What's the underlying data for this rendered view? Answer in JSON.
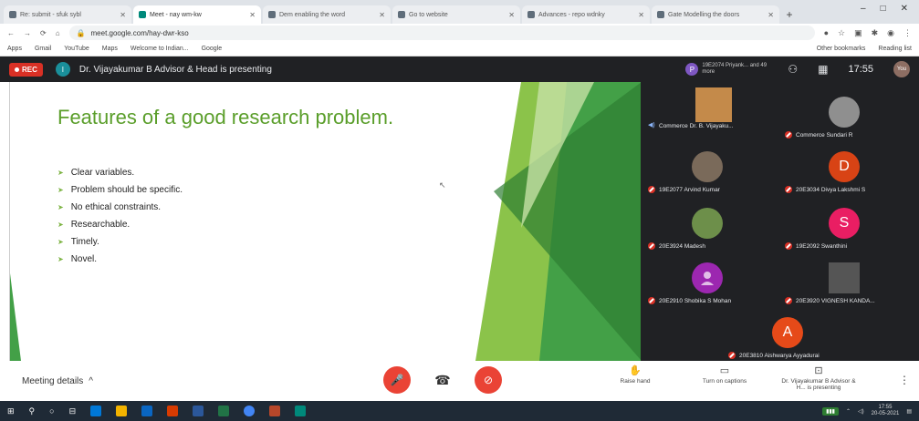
{
  "browser": {
    "tabs": [
      {
        "label": "Re: submit - sfuk sybl",
        "active": false
      },
      {
        "label": "Meet - nay wm-kw",
        "active": true
      },
      {
        "label": "Dem enabling the word",
        "active": false
      },
      {
        "label": "Go to website",
        "active": false
      },
      {
        "label": "Advances - repo wdnky",
        "active": false
      },
      {
        "label": "Gate Modelling the doors",
        "active": false
      }
    ],
    "new_tab": "+",
    "window_controls": [
      "–",
      "□",
      "✕"
    ],
    "url": "meet.google.com/hay-dwr-kso",
    "bookmarks": [
      "Apps",
      "Gmail",
      "YouTube",
      "Maps",
      "Welcome to Indian...",
      "Google"
    ],
    "bookmarks_right": [
      "Other bookmarks",
      "Reading list"
    ]
  },
  "meet": {
    "rec_label": "REC",
    "presenter_initial": "I",
    "presenting_text": "Dr. Vijayakumar B Advisor & Head is presenting",
    "pinned_initial": "P",
    "pinned_name": "19E2074 Priyank... and 49 more",
    "clock": "17:55",
    "you_label": "You"
  },
  "slide": {
    "title": "Features of a good research problem.",
    "bullets": [
      "Clear variables.",
      "Problem should be specific.",
      "No ethical constraints.",
      "Researchable.",
      "Timely.",
      "Novel."
    ],
    "cursor": "↖"
  },
  "participants": [
    {
      "name": "Commerce Dr. B. Vijayaku...",
      "kind": "photo",
      "color": "#c48a4a",
      "muted": false
    },
    {
      "name": "Commerce Sundari R",
      "kind": "photo",
      "color": "#8f8f8f",
      "muted": true
    },
    {
      "name": "19E2077 Arvind Kumar",
      "kind": "photo",
      "color": "#7a6a5a",
      "muted": true
    },
    {
      "name": "20E3034 Divya Lakshmi S",
      "kind": "letter",
      "letter": "D",
      "color": "#d84315",
      "muted": true
    },
    {
      "name": "20E3924 Madesh",
      "kind": "photo",
      "color": "#6d8f4a",
      "muted": true
    },
    {
      "name": "19E2092 Swanthini",
      "kind": "letter",
      "letter": "S",
      "color": "#e91e63",
      "muted": true
    },
    {
      "name": "20E2910 Shobika S Mohan",
      "kind": "letter",
      "letter": "",
      "color": "#9c27b0",
      "muted": true
    },
    {
      "name": "20E3920 VIGNESH KANDA...",
      "kind": "photo",
      "color": "#555555",
      "muted": true
    },
    {
      "name": "20E3810 Aishwarya Ayyadurai",
      "kind": "letter",
      "letter": "A",
      "color": "#e64a19",
      "muted": true
    }
  ],
  "toolbar": {
    "meeting_details": "Meeting details",
    "details_chevron": "^",
    "mic_icon": "🎤",
    "hangup_icon": "☎",
    "cam_icon": "⊘",
    "raise_hand": "Raise hand",
    "captions": "Turn on captions",
    "presenting": "Dr. Vijayakumar B Advisor & H... is presenting",
    "more": "⋮"
  },
  "taskbar": {
    "clock": "17:55",
    "date": "20-05-2021"
  }
}
